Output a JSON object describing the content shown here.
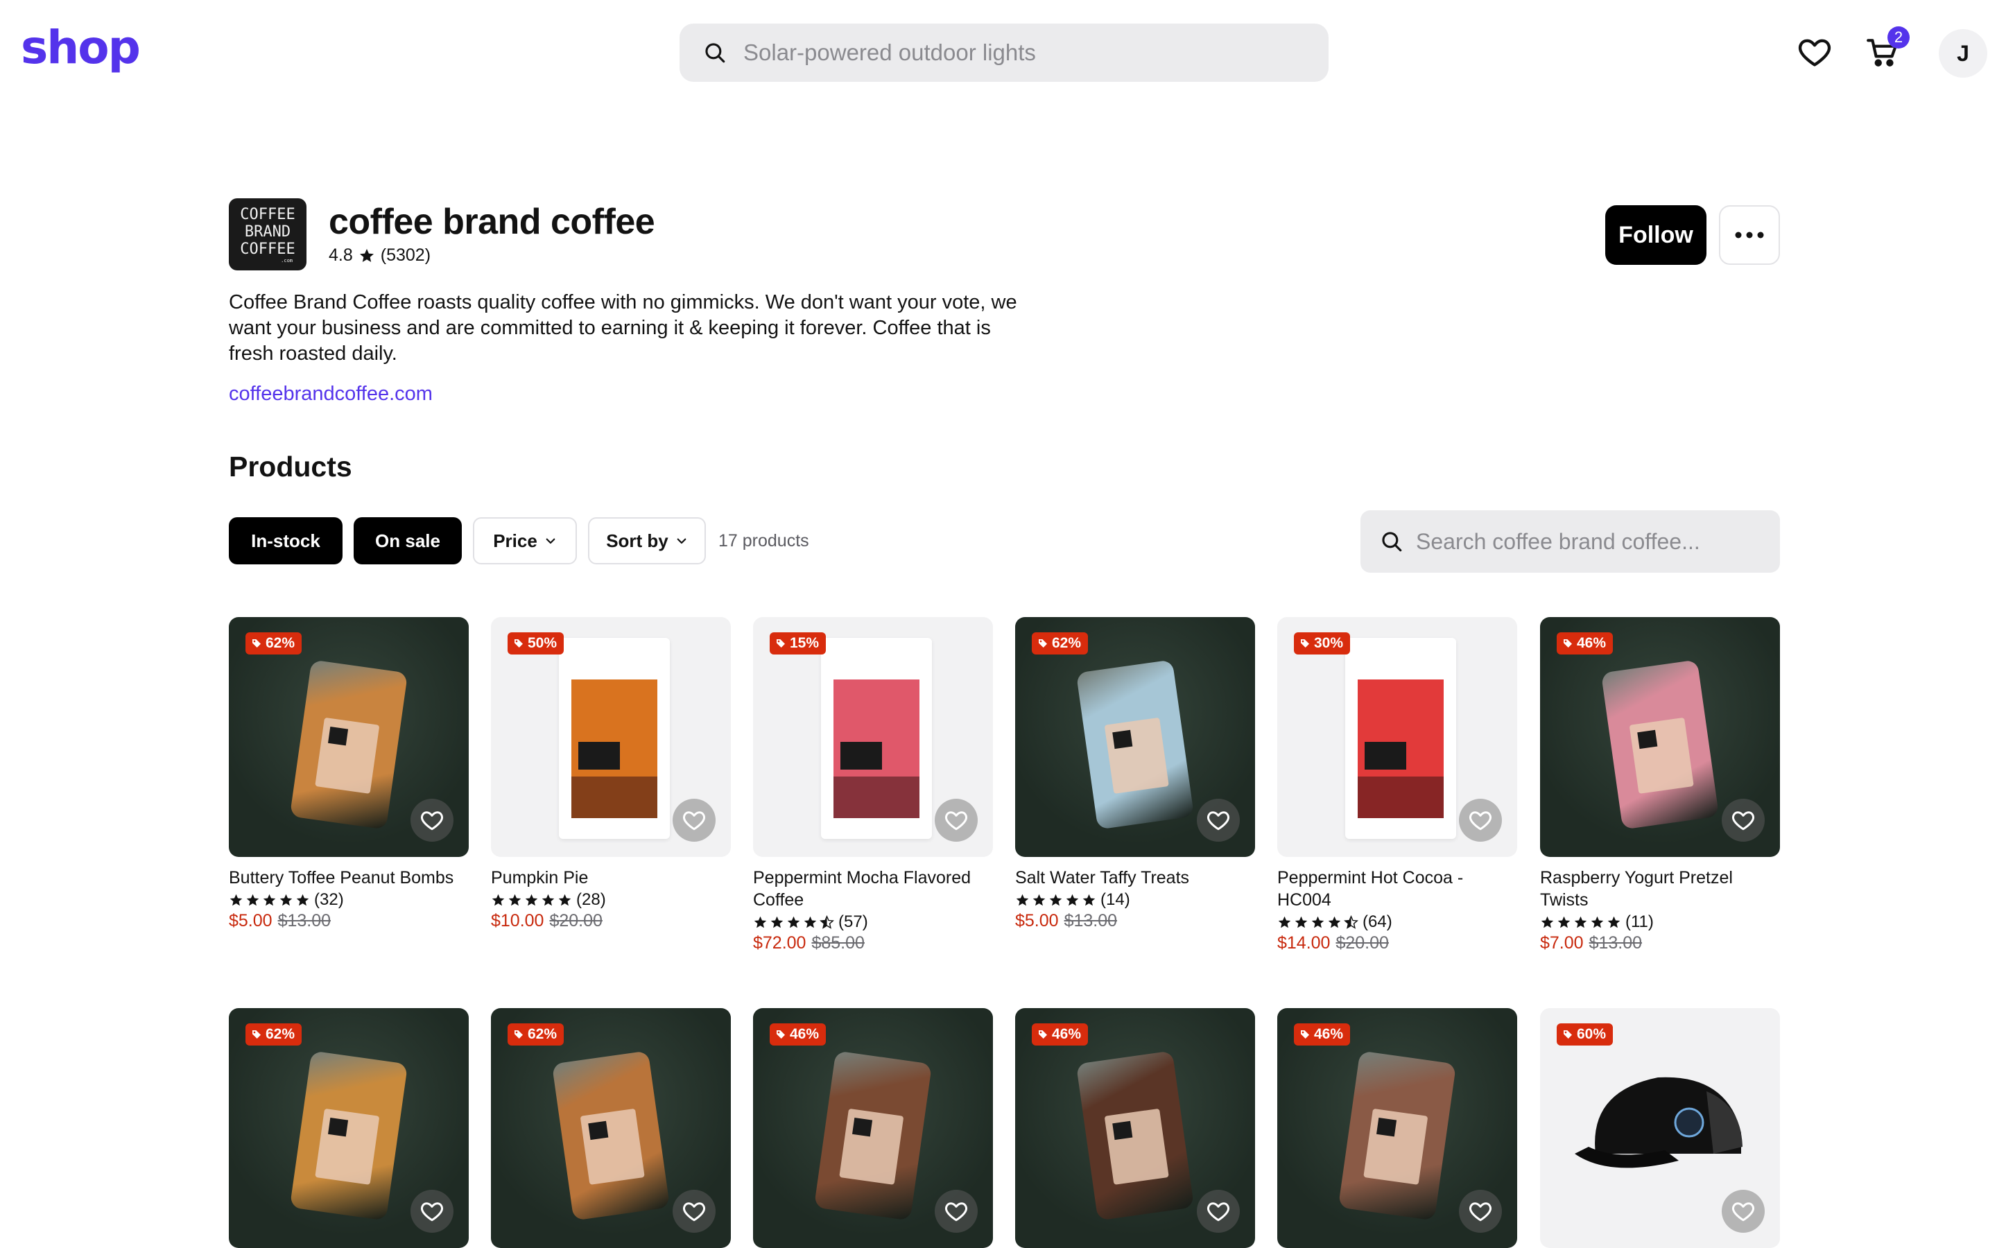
{
  "header": {
    "logo": "shop",
    "search_placeholder": "Solar-powered outdoor lights",
    "cart_count": "2",
    "avatar_initial": "J"
  },
  "shop": {
    "logo_lines": [
      "COFFEE",
      "BRAND",
      "COFFEE"
    ],
    "logo_suffix": ".com",
    "name": "coffee brand coffee",
    "rating": "4.8",
    "review_count": "(5302)",
    "follow_label": "Follow",
    "description": "Coffee Brand Coffee roasts quality coffee with no gimmicks. We don't want your vote, we want your business and are committed to earning it & keeping it forever. Coffee that is fresh roasted daily.",
    "website": "coffeebrandcoffee.com"
  },
  "products_section": {
    "title": "Products",
    "filters": [
      "In-stock",
      "On sale",
      "Price",
      "Sort by"
    ],
    "count": "17 products",
    "search_placeholder": "Search coffee brand coffee..."
  },
  "products": [
    {
      "title": "Buttery Toffee Peanut Bombs",
      "discount": "62%",
      "reviews": "(32)",
      "rating": 5,
      "price": "$5.00",
      "original": "$13.00",
      "bg": "dark",
      "kind": "bag",
      "color": "#c9843f"
    },
    {
      "title": "Pumpkin Pie",
      "discount": "50%",
      "reviews": "(28)",
      "rating": 5,
      "price": "$10.00",
      "original": "$20.00",
      "bg": "light",
      "kind": "pouch",
      "color": "#d9731f"
    },
    {
      "title": "Peppermint Mocha Flavored Coffee",
      "discount": "15%",
      "reviews": "(57)",
      "rating": 4.5,
      "price": "$72.00",
      "original": "$85.00",
      "bg": "light",
      "kind": "pouch",
      "color": "#e0586a"
    },
    {
      "title": "Salt Water Taffy Treats",
      "discount": "62%",
      "reviews": "(14)",
      "rating": 5,
      "price": "$5.00",
      "original": "$13.00",
      "bg": "dark",
      "kind": "bag",
      "color": "#a6c6d6"
    },
    {
      "title": "Peppermint Hot Cocoa - HC004",
      "discount": "30%",
      "reviews": "(64)",
      "rating": 4.5,
      "price": "$14.00",
      "original": "$20.00",
      "bg": "light",
      "kind": "pouch",
      "color": "#e23a3a"
    },
    {
      "title": "Raspberry Yogurt Pretzel Twists",
      "discount": "46%",
      "reviews": "(11)",
      "rating": 5,
      "price": "$7.00",
      "original": "$13.00",
      "bg": "dark",
      "kind": "bag",
      "color": "#d98a9a"
    },
    {
      "title": "",
      "discount": "62%",
      "bg": "dark",
      "kind": "bag",
      "color": "#c98a3c"
    },
    {
      "title": "",
      "discount": "62%",
      "bg": "dark",
      "kind": "bag",
      "color": "#b9743a"
    },
    {
      "title": "",
      "discount": "46%",
      "bg": "dark",
      "kind": "bag",
      "color": "#7a4a32"
    },
    {
      "title": "",
      "discount": "46%",
      "bg": "dark",
      "kind": "bag",
      "color": "#5a3526"
    },
    {
      "title": "",
      "discount": "46%",
      "bg": "dark",
      "kind": "bag",
      "color": "#8a5a46"
    },
    {
      "title": "",
      "discount": "60%",
      "bg": "light",
      "kind": "cap",
      "color": "#111111"
    }
  ],
  "colors": {
    "brand": "#5433EB",
    "sale": "#c8290d",
    "badge": "#d82c0d"
  }
}
